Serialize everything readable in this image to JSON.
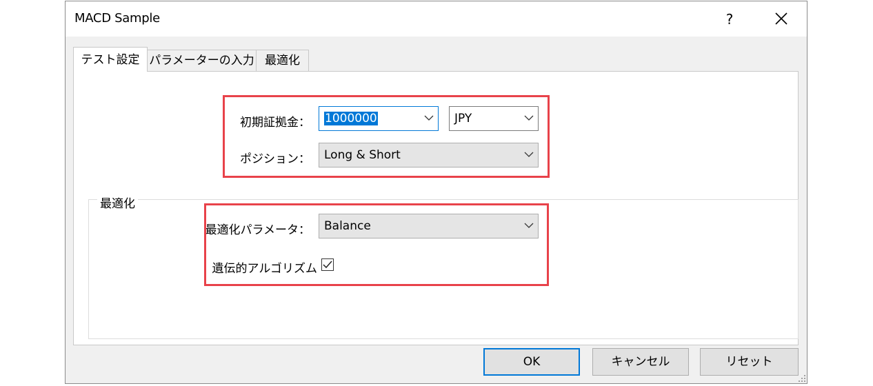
{
  "window": {
    "title": "MACD Sample",
    "help_label": "?",
    "close_icon": "close-icon"
  },
  "tabs": [
    {
      "label": "テスト設定",
      "active": true
    },
    {
      "label": "パラメーターの入力",
      "active": false
    },
    {
      "label": "最適化",
      "active": false
    }
  ],
  "settings": {
    "initial_deposit_label": "初期証拠金：",
    "initial_deposit_value": "1000000",
    "currency_value": "JPY",
    "position_label": "ポジション：",
    "position_value": "Long & Short"
  },
  "optimization_group": {
    "legend": "最適化",
    "parameter_label": "最適化パラメータ：",
    "parameter_value": "Balance",
    "genetic_label": "遺伝的アルゴリズム",
    "genetic_checked": true
  },
  "buttons": {
    "ok": "OK",
    "cancel": "キャンセル",
    "reset": "リセット"
  },
  "colors": {
    "highlight_box": "#e8424a",
    "selection": "#0078d7"
  }
}
